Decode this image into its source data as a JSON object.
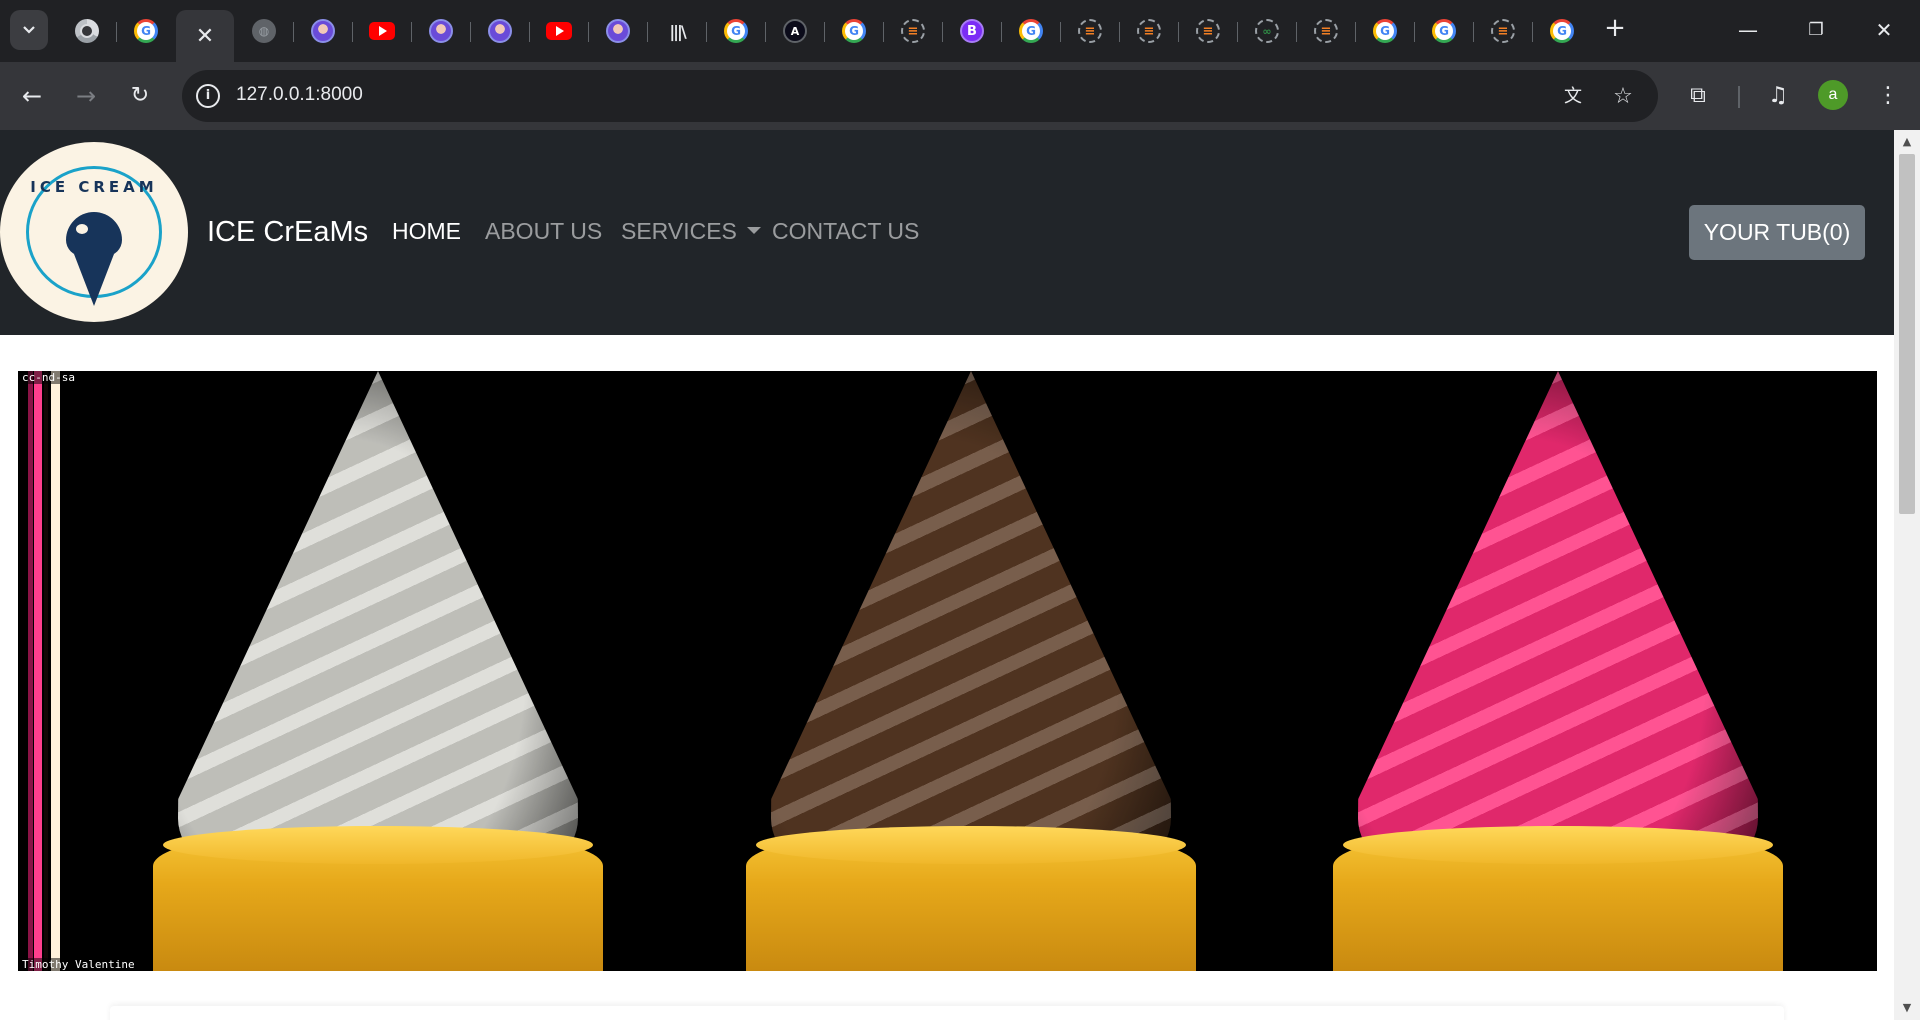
{
  "browser": {
    "tabs": [
      {
        "icon": "chrome-icon"
      },
      {
        "icon": "google-icon"
      },
      {
        "icon": "close-icon",
        "active": true
      },
      {
        "icon": "globe-icon"
      },
      {
        "icon": "avatar-icon"
      },
      {
        "icon": "youtube-icon"
      },
      {
        "icon": "avatar-icon"
      },
      {
        "icon": "avatar-icon"
      },
      {
        "icon": "youtube-icon"
      },
      {
        "icon": "avatar-icon"
      },
      {
        "icon": "library-icon"
      },
      {
        "icon": "google-icon"
      },
      {
        "icon": "astro-icon"
      },
      {
        "icon": "google-icon"
      },
      {
        "icon": "stackoverflow-icon"
      },
      {
        "icon": "bootstrap-icon"
      },
      {
        "icon": "google-icon"
      },
      {
        "icon": "stackoverflow-icon"
      },
      {
        "icon": "stackoverflow-icon"
      },
      {
        "icon": "stackoverflow-icon"
      },
      {
        "icon": "geeksforgeeks-icon"
      },
      {
        "icon": "stackoverflow-icon"
      },
      {
        "icon": "google-icon"
      },
      {
        "icon": "google-icon"
      },
      {
        "icon": "stackoverflow-icon"
      },
      {
        "icon": "google-icon"
      }
    ],
    "url": "127.0.0.1:8000",
    "profile_initial": "a"
  },
  "site": {
    "logo_text": "ICE CREAM",
    "brand": "ICE CrEaMs",
    "nav": {
      "home": "HOME",
      "about": "ABOUT US",
      "services": "SERVICES",
      "contact": "CONTACT US"
    },
    "cart_button": "YOUR TUB(0)",
    "hero": {
      "license": "cc-nd-sa",
      "credit": "Timothy Valentine",
      "cones": [
        {
          "flavor": "vanilla",
          "color": "#d8d8d2"
        },
        {
          "flavor": "chocolate",
          "color": "#5a3a24"
        },
        {
          "flavor": "strawberry",
          "color": "#ff2d7a"
        }
      ]
    }
  }
}
